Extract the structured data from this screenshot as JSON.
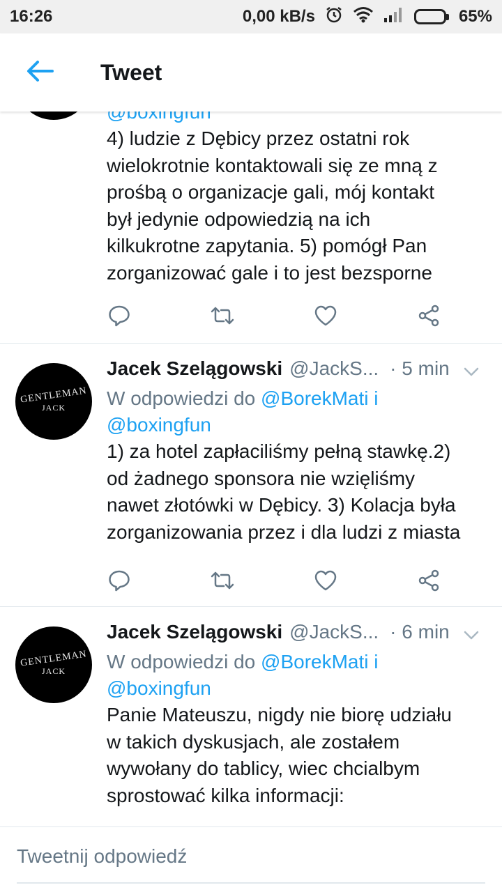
{
  "status_bar": {
    "time": "16:26",
    "network_speed": "0,00 kB/s",
    "battery_percent": "65%",
    "icons": [
      "alarm-icon",
      "wifi-icon",
      "signal-icon",
      "battery-icon"
    ]
  },
  "app_bar": {
    "back_icon": "arrow-left-icon",
    "title": "Tweet"
  },
  "colors": {
    "accent": "#1da1f2",
    "secondary_text": "#657786",
    "primary_text": "#14171a",
    "divider": "#e1e8ed"
  },
  "tweets": [
    {
      "partial_mention": "@boxingfun",
      "lines": [
        "4) ludzie z Dębicy przez ostatni rok",
        "wielokrotnie kontaktowali się ze mną z",
        "prośbą o organizacje gali, mój kontakt",
        "był jedynie odpowiedzią na ich",
        "kilkukrotne zapytania. 5) pomógł Pan",
        "zorganizować gale i to jest bezsporne"
      ]
    },
    {
      "name": "Jacek Szelągowski",
      "handle": "@JackS...",
      "time": "· 5 min",
      "reply_prefix": "W odpowiedzi do",
      "reply_mention": "@BorekMati",
      "reply_and": "i",
      "reply_mention2": "@boxingfun",
      "avatar": {
        "line1": "GENTLEMAN",
        "line2": "JACK"
      },
      "lines": [
        "1) za hotel zapłaciliśmy pełną stawkę.2)",
        "od żadnego sponsora nie wzięliśmy",
        "nawet złotówki w Dębicy. 3) Kolacja była",
        "zorganizowania przez i dla ludzi z miasta"
      ]
    },
    {
      "name": "Jacek Szelągowski",
      "handle": "@JackS...",
      "time": "· 6 min",
      "reply_prefix": "W odpowiedzi do",
      "reply_mention": "@BorekMati",
      "reply_and": "i",
      "reply_mention2": "@boxingfun",
      "avatar": {
        "line1": "GENTLEMAN",
        "line2": "JACK"
      },
      "lines": [
        "Panie Mateuszu, nigdy nie biorę udziału",
        "w takich dyskusjach, ale zostałem",
        "wywołany do tablicy, wiec chcialbym",
        "sprostować kilka informacji:"
      ]
    }
  ],
  "action_icons": [
    "reply-icon",
    "retweet-icon",
    "like-icon",
    "share-icon"
  ],
  "reply_bar": {
    "placeholder": "Tweetnij odpowiedź"
  }
}
